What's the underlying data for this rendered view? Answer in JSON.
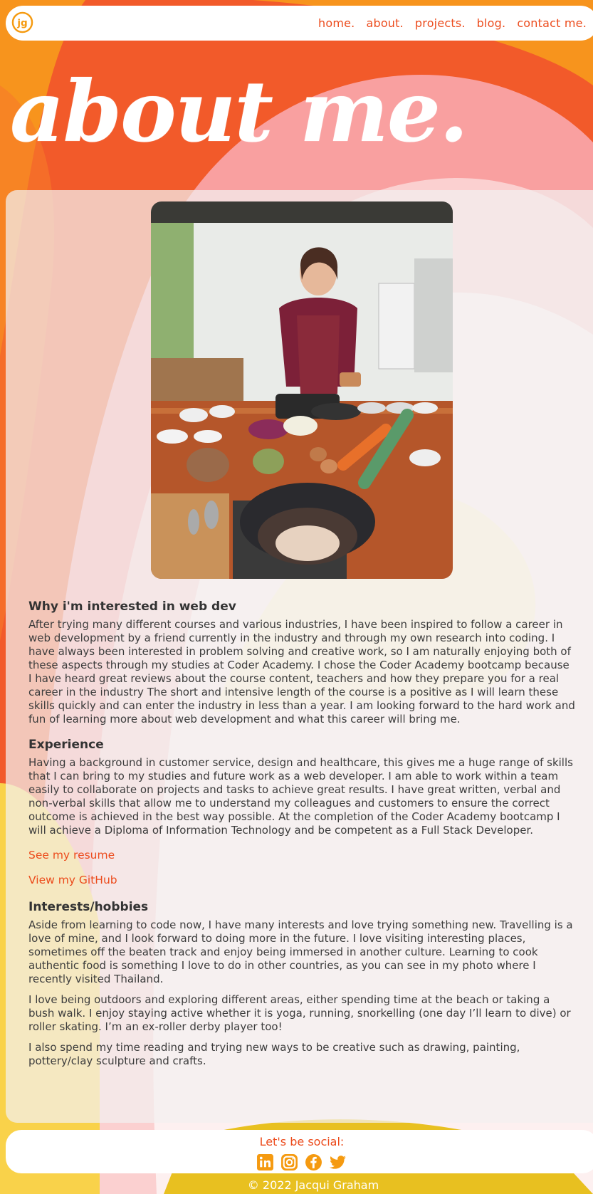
{
  "nav": {
    "logo_text": "jg",
    "links": [
      "home.",
      "about.",
      "projects.",
      "blog.",
      "contact me."
    ]
  },
  "hero": {
    "title": "about me."
  },
  "sections": [
    {
      "heading": "Why i'm interested in web dev",
      "paragraphs": [
        "After trying many different courses and various industries, I have been inspired to follow a career in web development by a friend currently in the industry and through my own research into coding. I have always been interested in problem solving and creative work, so I am naturally enjoying both of these aspects through my studies at Coder Academy. I chose the Coder Academy bootcamp because I have heard great reviews about the course content, teachers and how they prepare you for a real career in the industry The short and intensive length of the course is a positive as I will learn these skills quickly and can enter the industry in less than a year. I am looking forward to the hard work and fun of learning more about web development and what this career will bring me."
      ]
    },
    {
      "heading": "Experience",
      "paragraphs": [
        "Having a background in customer service, design and healthcare, this gives me a huge range of skills that I can bring to my studies and future work as a web developer. I am able to work within a team easily to collaborate on projects and tasks to achieve great results. I have great written, verbal and non-verbal skills that allow me to understand my colleagues and customers to ensure the correct outcome is achieved in the best way possible. At the completion of the Coder Academy bootcamp I will achieve a Diploma of Information Technology and be competent as a Full Stack Developer."
      ]
    },
    {
      "heading": "Interests/hobbies",
      "paragraphs": [
        "Aside from learning to code now, I have many interests and love trying something new. Travelling is a love of mine, and I look forward to doing more in the future. I love visiting interesting places, sometimes off the beaten track and enjoy being immersed in another culture. Learning to cook authentic food is something I love to do in other countries, as you can see in my photo where I recently visited Thailand.",
        "I love being outdoors and exploring different areas, either spending time at the beach or taking a bush walk. I enjoy staying active whether it is yoga, running, snorkelling (one day I’ll learn to dive) or roller skating. I’m an ex-roller derby player too!",
        "I also spend my time reading and trying new ways to be creative such as drawing, painting, pottery/clay sculpture and crafts."
      ]
    }
  ],
  "links": {
    "resume": "See my resume",
    "github": "View my GitHub"
  },
  "footer": {
    "title": "Let's be social:",
    "icons": [
      "linkedin-icon",
      "instagram-icon",
      "facebook-icon",
      "twitter-icon"
    ],
    "copyright": "© 2022 Jacqui Graham"
  },
  "colors": {
    "accent": "#ec4b1c",
    "icon_gold": "#f59a10"
  }
}
